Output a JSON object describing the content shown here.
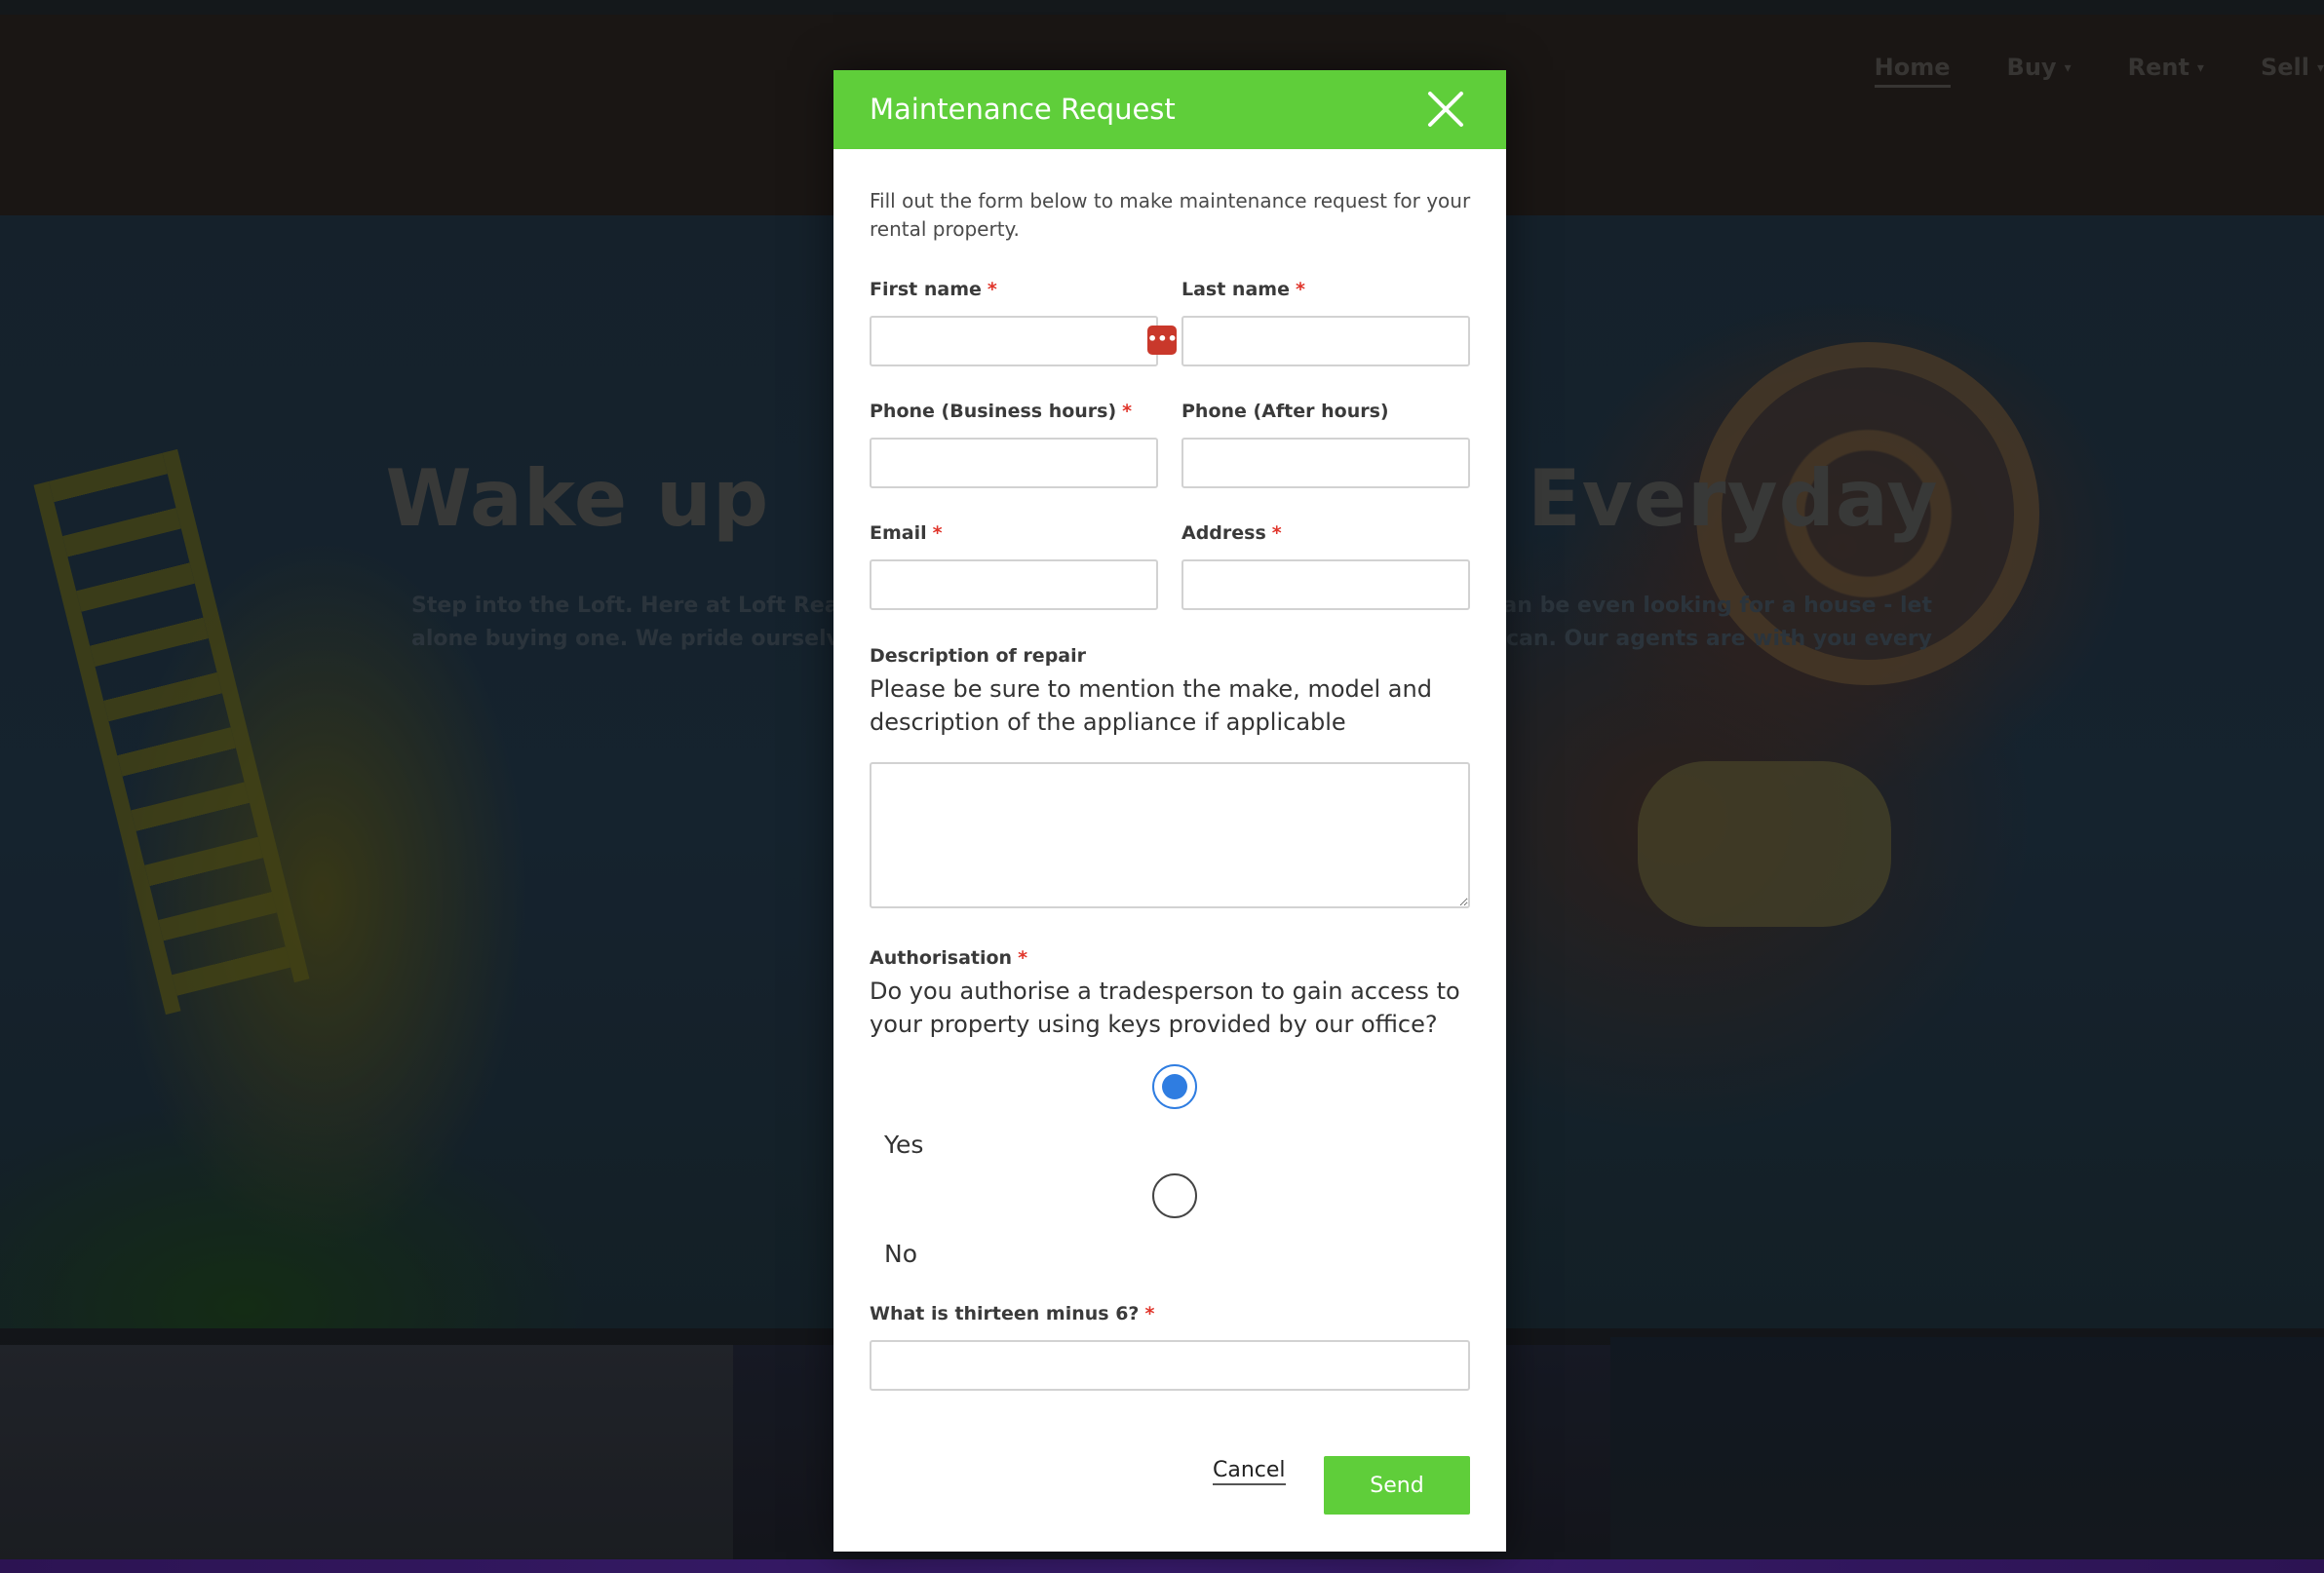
{
  "nav": {
    "items": [
      {
        "label": "Home",
        "active": true,
        "dropdown": false
      },
      {
        "label": "Buy",
        "active": false,
        "dropdown": true
      },
      {
        "label": "Rent",
        "active": false,
        "dropdown": true
      },
      {
        "label": "Sell",
        "active": false,
        "dropdown": true
      }
    ]
  },
  "hero": {
    "headline_left": "Wake up",
    "headline_right": "Everyday",
    "sub_line1_left": "Step into the Loft. Here at Loft Realty",
    "sub_line1_right": "can be even looking for a house - let",
    "sub_line2_left": "alone buying one. We pride ourselv",
    "sub_line2_right": "can. Our agents are with you every"
  },
  "modal": {
    "title": "Maintenance Request",
    "close_icon": "close-icon",
    "intro": "Fill out the form below to make maintenance request for your rental property.",
    "fields": {
      "first_name": {
        "label": "First name",
        "required": "*",
        "value": ""
      },
      "last_name": {
        "label": "Last name",
        "required": "*",
        "value": ""
      },
      "phone_business": {
        "label": "Phone (Business hours)",
        "required": "*",
        "value": ""
      },
      "phone_after": {
        "label": "Phone (After hours)",
        "value": ""
      },
      "email": {
        "label": "Email",
        "required": "*",
        "value": ""
      },
      "address": {
        "label": "Address",
        "required": "*",
        "value": ""
      },
      "description": {
        "label": "Description of repair",
        "help": "Please be sure to mention the make, model and description of the appliance if applicable",
        "value": ""
      },
      "authorisation": {
        "label": "Authorisation",
        "required": "*",
        "help": "Do you authorise a tradesperson to gain access to your property using keys provided by our office?",
        "options": [
          {
            "label": "Yes",
            "checked": true
          },
          {
            "label": "No",
            "checked": false
          }
        ]
      },
      "captcha": {
        "label": "What is thirteen minus 6?",
        "required": "*",
        "value": ""
      }
    },
    "password_manager_icon": "•••|",
    "actions": {
      "cancel": "Cancel",
      "send": "Send"
    }
  },
  "colors": {
    "accent_green": "#5fce3a",
    "required_red": "#e0352b",
    "radio_blue": "#2f7de1"
  }
}
